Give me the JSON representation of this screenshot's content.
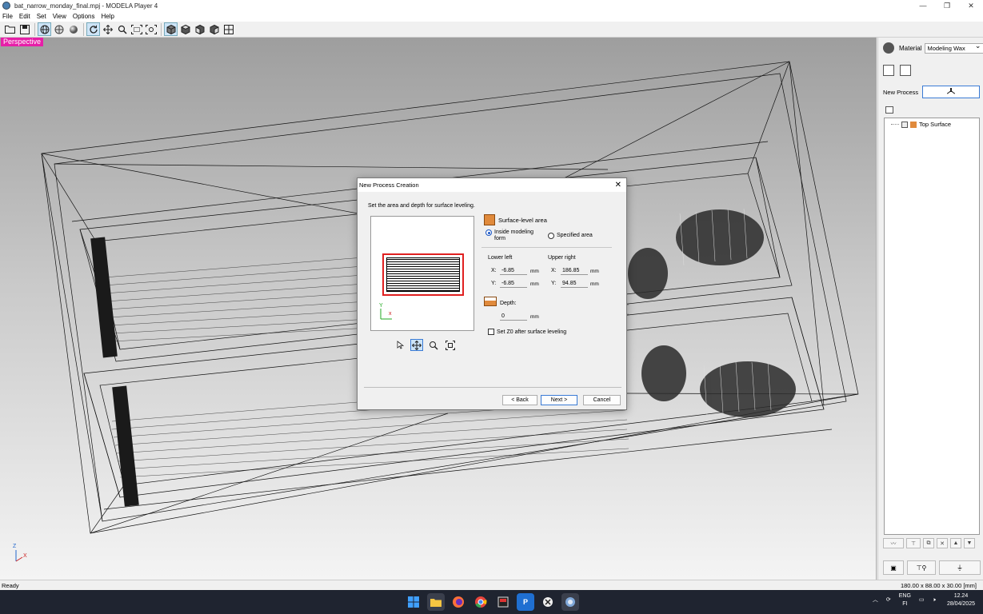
{
  "window": {
    "title": "bat_narrow_monday_final.mpj - MODELA Player 4",
    "minimize_glyph": "—",
    "maximize_glyph": "❐",
    "close_glyph": "✕"
  },
  "menu": [
    {
      "label": "File"
    },
    {
      "label": "Edit"
    },
    {
      "label": "Set"
    },
    {
      "label": "View"
    },
    {
      "label": "Options"
    },
    {
      "label": "Help"
    }
  ],
  "viewport": {
    "view_label": "Perspective",
    "axis_z": "Z",
    "axis_x": "X"
  },
  "right_panel": {
    "material_label": "Material",
    "material_value": "Modeling Wax",
    "new_process_label": "New Process",
    "tree_items": [
      {
        "label": "Top Surface"
      }
    ]
  },
  "status": {
    "left": "Ready",
    "right": "180.00 x 88.00 x 30.00 [mm]"
  },
  "dialog": {
    "title": "New Process Creation",
    "close_glyph": "✕",
    "instruction": "Set the area and depth for surface leveling.",
    "preview_axis_y": "Y",
    "preview_axis_x": "x",
    "section_title": "Surface-level area",
    "option_inside": "Inside modeling form",
    "option_specified": "Specified area",
    "lower_left_label": "Lower left",
    "upper_right_label": "Upper right",
    "x_label": "X:",
    "y_label": "Y:",
    "lower_left_x": "-6.85",
    "lower_left_y": "-6.85",
    "upper_right_x": "186.85",
    "upper_right_y": "94.85",
    "unit": "mm",
    "depth_label": "Depth:",
    "depth_value": "0",
    "checkbox_label": "Set Z0 after surface leveling",
    "back_button": "< Back",
    "next_button": "Next >",
    "cancel_button": "Cancel"
  },
  "taskbar": {
    "language": "ENG",
    "region": "FI",
    "time": "12.24",
    "date": "28/04/2025"
  },
  "colors": {
    "perspective_badge": "#e61fa8",
    "selection_frame": "#e02020",
    "accent": "#3a7bd5",
    "surface_icon": "#e08a3c"
  }
}
